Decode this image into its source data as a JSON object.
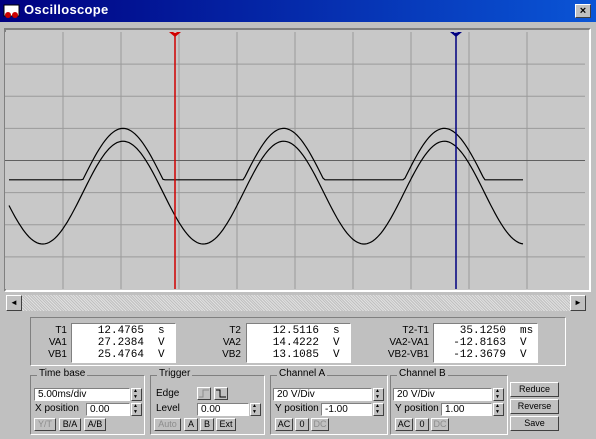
{
  "window": {
    "title": "Oscilloscope",
    "close_glyph": "×"
  },
  "colors": {
    "trace": "#000000",
    "cursor1": "#d00000",
    "cursor2": "#000080",
    "grid": "#9a9a9a",
    "screen_bg": "#c8c8c8"
  },
  "screen": {
    "cursor1_label": "1",
    "cursor2_label": "2",
    "chart_data": {
      "type": "line",
      "time_per_div_ms": 5,
      "x_divisions": 10,
      "y_divisions": 8,
      "series": [
        {
          "shape": "half-wave rectified sine (clipped at zero)",
          "period_div": 2.77,
          "amplitude_div": 1.6,
          "center_div": 3.0
        },
        {
          "shape": "sine",
          "period_div": 2.77,
          "amplitude_div": 1.6,
          "center_div": 5.0
        }
      ]
    }
  },
  "scrollbar": {
    "left_arrow": "◄",
    "right_arrow": "►"
  },
  "measurements": {
    "left": {
      "labels": [
        "T1",
        "VA1",
        "VB1"
      ],
      "values": [
        "12.4765",
        "27.2384",
        "25.4764"
      ],
      "units": [
        "s",
        "V",
        "V"
      ]
    },
    "middle": {
      "labels": [
        "T2",
        "VA2",
        "VB2"
      ],
      "values": [
        "12.5116",
        "14.4222",
        "13.1085"
      ],
      "units": [
        "s",
        "V",
        "V"
      ]
    },
    "right": {
      "labels": [
        "T2-T1",
        "VA2-VA1",
        "VB2-VB1"
      ],
      "values": [
        "35.1250",
        "-12.8163",
        "-12.3679"
      ],
      "units": [
        "ms",
        "V",
        "V"
      ]
    }
  },
  "time_base": {
    "title": "Time base",
    "scale": "5.00ms/div",
    "xpos_label": "X position",
    "xpos_value": "0.00",
    "buttons": [
      "Y/T",
      "B/A",
      "A/B"
    ]
  },
  "trigger": {
    "title": "Trigger",
    "edge_label": "Edge",
    "level_label": "Level",
    "level_value": "0.00",
    "edge_rise_icon": "rising-edge",
    "edge_fall_icon": "falling-edge",
    "buttons": [
      "Auto",
      "A",
      "B",
      "Ext"
    ]
  },
  "channel_a": {
    "title": "Channel A",
    "scale": "20 V/Div",
    "ypos_label": "Y position",
    "ypos_value": "-1.00",
    "buttons": [
      "AC",
      "0",
      "DC"
    ]
  },
  "channel_b": {
    "title": "Channel B",
    "scale": "20 V/Div",
    "ypos_label": "Y position",
    "ypos_value": "1.00",
    "buttons": [
      "AC",
      "0",
      "DC"
    ]
  },
  "side_buttons": {
    "reduce": "Reduce",
    "reverse": "Reverse",
    "save": "Save"
  }
}
